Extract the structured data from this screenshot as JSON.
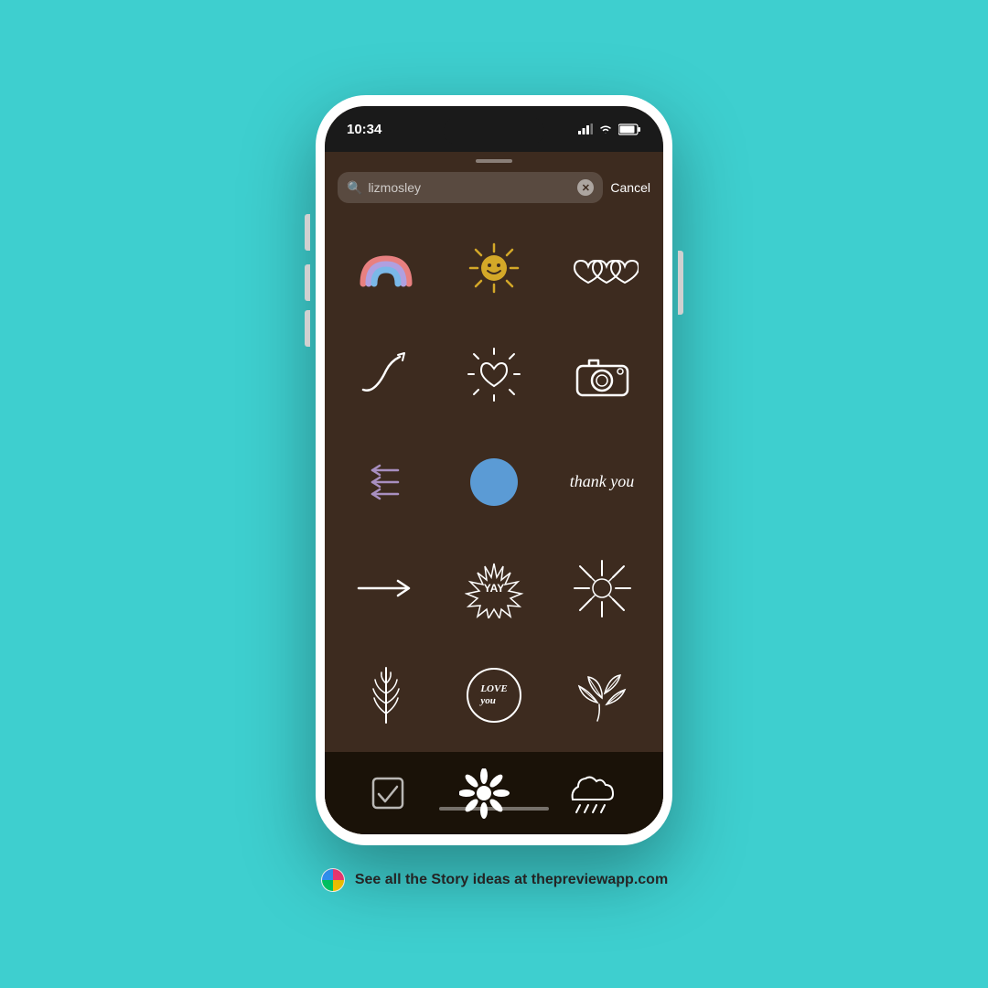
{
  "background_color": "#3ecfcf",
  "footer": {
    "text": "See all the Story ideas at thepreviewapp.com",
    "app_icon_colors": [
      "#ff3b7a",
      "#ffcc00",
      "#00cc66",
      "#3399ff"
    ]
  },
  "phone": {
    "status_bar": {
      "time": "10:34",
      "signal": "signal",
      "wifi": "wifi",
      "battery": "battery"
    },
    "search": {
      "placeholder": "lizmosley",
      "cancel_label": "Cancel"
    },
    "stickers": [
      {
        "id": "rainbow",
        "label": "rainbow icon"
      },
      {
        "id": "sun",
        "label": "sun icon"
      },
      {
        "id": "hearts",
        "label": "three hearts icon"
      },
      {
        "id": "squiggle",
        "label": "squiggle icon"
      },
      {
        "id": "heart-rays",
        "label": "heart with rays icon"
      },
      {
        "id": "camera",
        "label": "camera icon"
      },
      {
        "id": "arrows",
        "label": "three arrows left icon"
      },
      {
        "id": "blue-blob",
        "label": "blue blob icon"
      },
      {
        "id": "thank-you",
        "label": "thank you text"
      },
      {
        "id": "arrow-right",
        "label": "arrow right icon"
      },
      {
        "id": "yay",
        "label": "yay burst icon"
      },
      {
        "id": "starburst",
        "label": "starburst icon"
      },
      {
        "id": "fern",
        "label": "fern leaf icon"
      },
      {
        "id": "love-you",
        "label": "love you circle icon"
      },
      {
        "id": "autumn-leaves",
        "label": "autumn leaves icon"
      },
      {
        "id": "checkbox",
        "label": "checkbox icon"
      },
      {
        "id": "daisy",
        "label": "daisy icon"
      },
      {
        "id": "rain-cloud",
        "label": "rain cloud icon"
      }
    ]
  }
}
